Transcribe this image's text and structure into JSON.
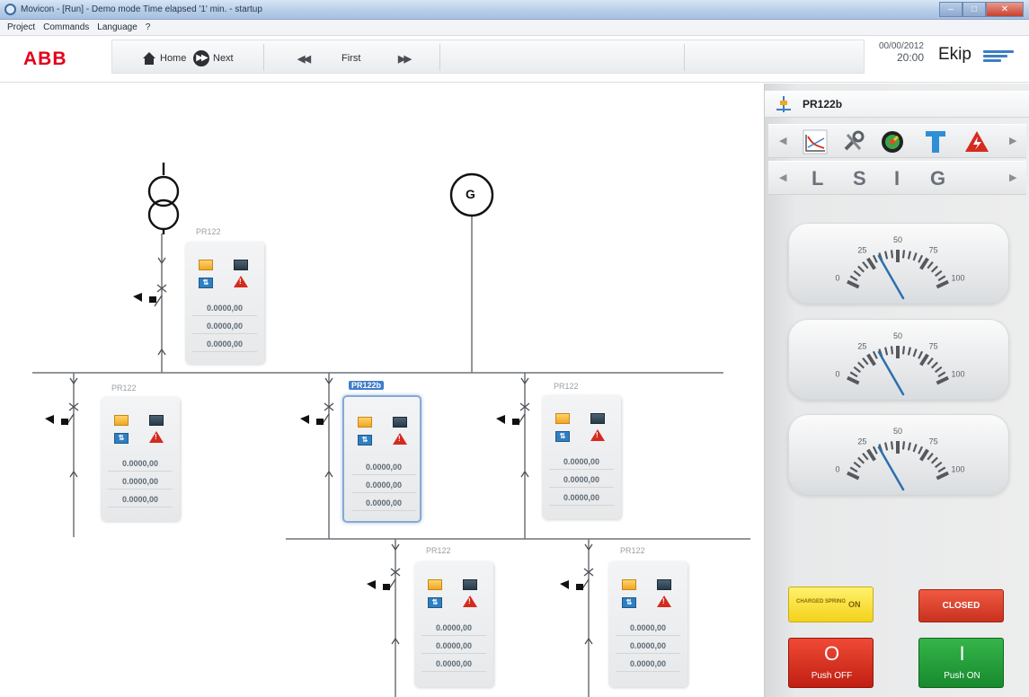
{
  "window": {
    "title": "Movicon - [Run] - Demo mode Time elapsed '1' min. - startup",
    "controls": {
      "minimize": "–",
      "maximize": "□",
      "close": "✕"
    }
  },
  "menu": [
    "Project",
    "Commands",
    "Language",
    "?"
  ],
  "toolbar": {
    "logo": "ABB",
    "home_label": "Home",
    "next_label": "Next",
    "prev_arrow": "◀◀",
    "first_label": "First",
    "next_arrow": "▶▶",
    "date": "00/00/2012",
    "time": "20:00",
    "brand": "Ekip"
  },
  "diagram": {
    "generator_label": "G",
    "relays": [
      {
        "label": "PR122",
        "values": [
          "0.0000,00",
          "0.0000,00",
          "0.0000,00"
        ]
      },
      {
        "label": "PR122",
        "values": [
          "0.0000,00",
          "0.0000,00",
          "0.0000,00"
        ]
      },
      {
        "label": "PR122b",
        "values": [
          "0.0000,00",
          "0.0000,00",
          "0.0000,00"
        ]
      },
      {
        "label": "PR122",
        "values": [
          "0.0000,00",
          "0.0000,00",
          "0.0000,00"
        ]
      },
      {
        "label": "PR122",
        "values": [
          "0.0000,00",
          "0.0000,00",
          "0.0000,00"
        ]
      },
      {
        "label": "PR122",
        "values": [
          "0.0000,00",
          "0.0000,00",
          "0.0000,00"
        ]
      }
    ]
  },
  "panel": {
    "title": "PR122b",
    "tools": [
      "curve-icon",
      "wrench-icon",
      "meter-icon",
      "t-icon",
      "alarm-icon"
    ],
    "tabs": [
      "L",
      "S",
      "I",
      "G"
    ],
    "gauges": [
      {
        "ticks": [
          "0",
          "25",
          "50",
          "75",
          "100"
        ],
        "value": 50
      },
      {
        "ticks": [
          "0",
          "25",
          "50",
          "75",
          "100"
        ],
        "value": 50
      },
      {
        "ticks": [
          "0",
          "25",
          "50",
          "75",
          "100"
        ],
        "value": 50
      }
    ],
    "charged_spring_label": "CHARGED SPRING",
    "charged_spring_state": "ON",
    "closed_label": "CLOSED",
    "push_off_symbol": "O",
    "push_off_label": "Push OFF",
    "push_on_symbol": "I",
    "push_on_label": "Push ON"
  },
  "colors": {
    "abb_red": "#e2001a",
    "accent_blue": "#3f7ec9",
    "on_green": "#1f9a36",
    "off_red": "#d42b1e",
    "spring_yellow": "#f4d21a"
  }
}
